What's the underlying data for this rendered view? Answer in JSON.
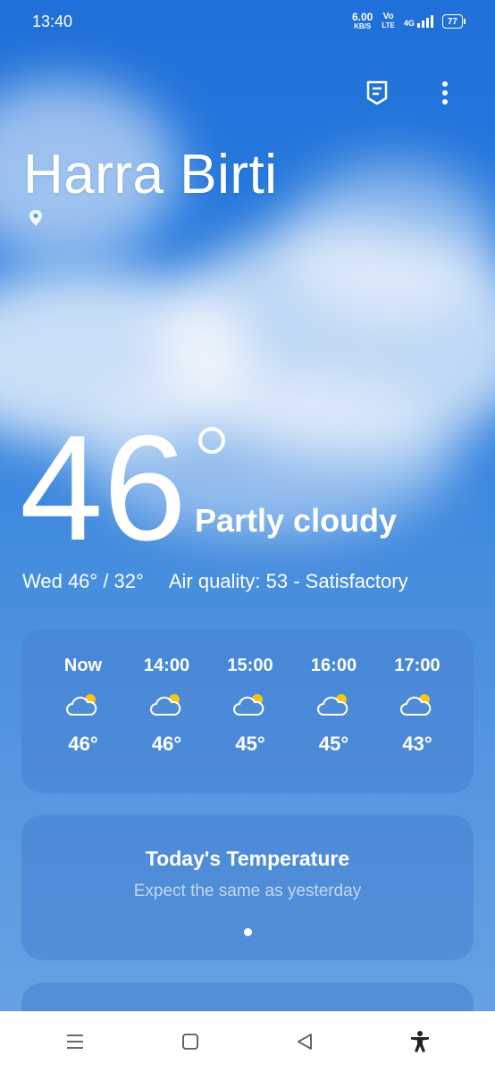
{
  "status_bar": {
    "time": "13:40",
    "speed_value": "6.00",
    "speed_unit": "KB/S",
    "volte_top": "Vo",
    "volte_bottom": "LTE",
    "network": "4G",
    "battery": "77"
  },
  "header": {
    "city": "Harra Birti"
  },
  "current": {
    "temperature": "46",
    "condition": "Partly cloudy",
    "day_range": "Wed 46° / 32°",
    "air_quality": "Air quality: 53 - Satisfactory"
  },
  "hourly": [
    {
      "time": "Now",
      "temp": "46°",
      "icon": "partly-cloudy-icon"
    },
    {
      "time": "14:00",
      "temp": "46°",
      "icon": "partly-cloudy-icon"
    },
    {
      "time": "15:00",
      "temp": "45°",
      "icon": "partly-cloudy-icon"
    },
    {
      "time": "16:00",
      "temp": "45°",
      "icon": "partly-cloudy-icon"
    },
    {
      "time": "17:00",
      "temp": "43°",
      "icon": "partly-cloudy-icon"
    }
  ],
  "today_card": {
    "title": "Today's Temperature",
    "subtitle": "Expect the same as yesterday"
  },
  "colors": {
    "sun": "#f5c518",
    "nav_icon": "#555555"
  }
}
